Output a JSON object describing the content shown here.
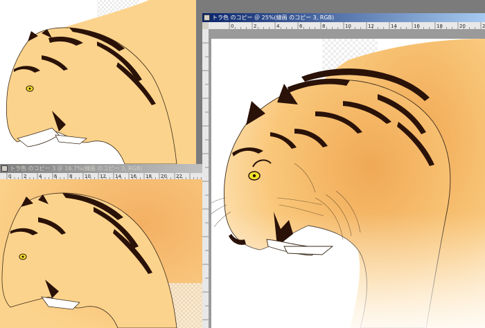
{
  "windows": {
    "main": {
      "title": "トラ色 のコピー ＠ 25%(線画 のコピー 3, RGB)"
    },
    "bottom_left": {
      "title": "トラ色 のコピー 3 ＠ 16.7%(線画 のコピー 3, RGB)"
    }
  },
  "ruler_labels": {
    "main": [
      "0",
      "2",
      "4",
      "6",
      "8",
      "10",
      "12",
      "14",
      "16",
      "18",
      "20",
      "22"
    ],
    "bottom_left": [
      "0",
      "2",
      "4",
      "6",
      "8",
      "10",
      "12",
      "14",
      "16",
      "18",
      "20",
      "22"
    ]
  },
  "icons": {
    "window": "document-window-icon",
    "close": "close-icon"
  },
  "colors": {
    "title_active": "#0a246a",
    "title_inactive": "#808080",
    "fur_orange": "#f9c77a",
    "stripe": "#2a1208",
    "eye": "#f2e22c"
  }
}
